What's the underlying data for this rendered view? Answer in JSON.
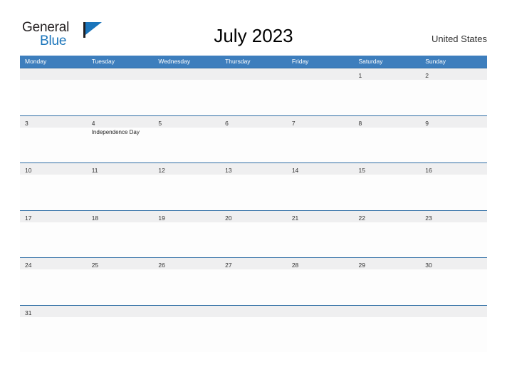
{
  "brand": {
    "name_part1": "General",
    "name_part2": "Blue",
    "flag_icon": "flag-icon"
  },
  "header": {
    "title": "July 2023",
    "country": "United States"
  },
  "calendar": {
    "weekdays": [
      "Monday",
      "Tuesday",
      "Wednesday",
      "Thursday",
      "Friday",
      "Saturday",
      "Sunday"
    ],
    "weeks": [
      [
        {
          "date": "",
          "event": ""
        },
        {
          "date": "",
          "event": ""
        },
        {
          "date": "",
          "event": ""
        },
        {
          "date": "",
          "event": ""
        },
        {
          "date": "",
          "event": ""
        },
        {
          "date": "1",
          "event": ""
        },
        {
          "date": "2",
          "event": ""
        }
      ],
      [
        {
          "date": "3",
          "event": ""
        },
        {
          "date": "4",
          "event": "Independence Day"
        },
        {
          "date": "5",
          "event": ""
        },
        {
          "date": "6",
          "event": ""
        },
        {
          "date": "7",
          "event": ""
        },
        {
          "date": "8",
          "event": ""
        },
        {
          "date": "9",
          "event": ""
        }
      ],
      [
        {
          "date": "10",
          "event": ""
        },
        {
          "date": "11",
          "event": ""
        },
        {
          "date": "12",
          "event": ""
        },
        {
          "date": "13",
          "event": ""
        },
        {
          "date": "14",
          "event": ""
        },
        {
          "date": "15",
          "event": ""
        },
        {
          "date": "16",
          "event": ""
        }
      ],
      [
        {
          "date": "17",
          "event": ""
        },
        {
          "date": "18",
          "event": ""
        },
        {
          "date": "19",
          "event": ""
        },
        {
          "date": "20",
          "event": ""
        },
        {
          "date": "21",
          "event": ""
        },
        {
          "date": "22",
          "event": ""
        },
        {
          "date": "23",
          "event": ""
        }
      ],
      [
        {
          "date": "24",
          "event": ""
        },
        {
          "date": "25",
          "event": ""
        },
        {
          "date": "26",
          "event": ""
        },
        {
          "date": "27",
          "event": ""
        },
        {
          "date": "28",
          "event": ""
        },
        {
          "date": "29",
          "event": ""
        },
        {
          "date": "30",
          "event": ""
        }
      ],
      [
        {
          "date": "31",
          "event": ""
        },
        {
          "date": "",
          "event": ""
        },
        {
          "date": "",
          "event": ""
        },
        {
          "date": "",
          "event": ""
        },
        {
          "date": "",
          "event": ""
        },
        {
          "date": "",
          "event": ""
        },
        {
          "date": "",
          "event": ""
        }
      ]
    ]
  },
  "colors": {
    "header_blue": "#3d7ebd",
    "row_line_blue": "#2e6da4",
    "band_gray": "#efeff0",
    "brand_blue": "#1b75bb",
    "text_dark": "#333333"
  }
}
